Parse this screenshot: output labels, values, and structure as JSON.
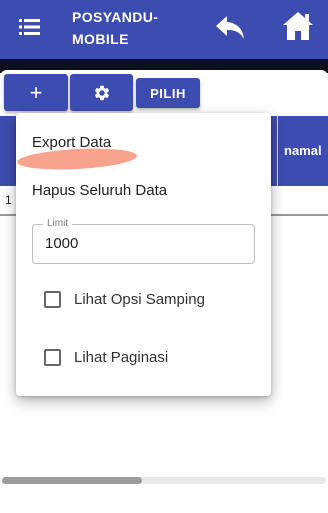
{
  "header": {
    "title": "POSYANDU-MOBILE",
    "menu_icon": "hamburger-menu-icon",
    "back_icon": "reply-arrow-icon",
    "home_icon": "home-icon"
  },
  "toolbar": {
    "add_label": "+",
    "gear_icon": "gear-icon",
    "pilih_label": "PILIH"
  },
  "table": {
    "visible_column": "namal",
    "first_row_number": "1"
  },
  "menu": {
    "export_label": "Export Data",
    "hapus_label": "Hapus Seluruh Data",
    "limit_label": "Limit",
    "limit_value": "1000",
    "side_option_label": "Lihat Opsi Samping",
    "pagination_label": "Lihat Paginasi"
  },
  "colors": {
    "primary": "#3d4cb0",
    "highlight": "#f7a38d"
  }
}
